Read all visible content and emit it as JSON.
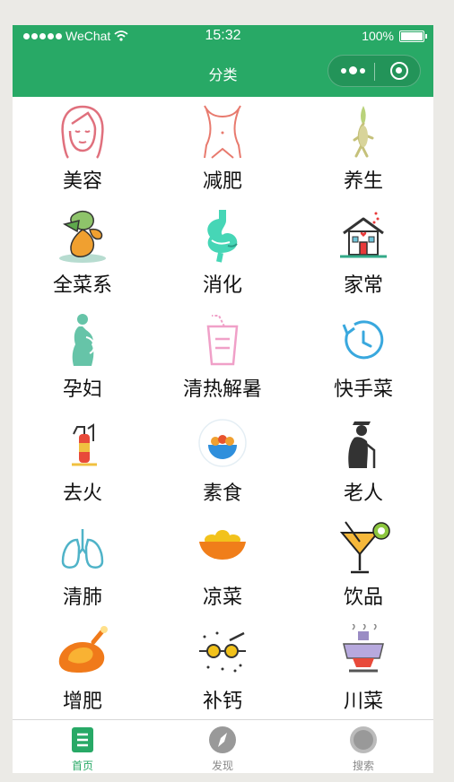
{
  "status_bar": {
    "carrier": "WeChat",
    "time": "15:32",
    "battery": "100%"
  },
  "nav": {
    "title": "分类"
  },
  "categories": [
    {
      "label": "美容",
      "icon": "woman-face-icon"
    },
    {
      "label": "减肥",
      "icon": "waist-icon"
    },
    {
      "label": "养生",
      "icon": "ginseng-icon"
    },
    {
      "label": "全菜系",
      "icon": "vegetables-icon"
    },
    {
      "label": "消化",
      "icon": "stomach-icon"
    },
    {
      "label": "家常",
      "icon": "house-icon"
    },
    {
      "label": "孕妇",
      "icon": "pregnant-woman-icon"
    },
    {
      "label": "清热解暑",
      "icon": "drink-cup-icon"
    },
    {
      "label": "快手菜",
      "icon": "clock-icon"
    },
    {
      "label": "去火",
      "icon": "fire-extinguisher-icon"
    },
    {
      "label": "素食",
      "icon": "salad-bowl-icon"
    },
    {
      "label": "老人",
      "icon": "elderly-person-icon"
    },
    {
      "label": "清肺",
      "icon": "lungs-icon"
    },
    {
      "label": "凉菜",
      "icon": "cold-dish-icon"
    },
    {
      "label": "饮品",
      "icon": "cocktail-icon"
    },
    {
      "label": "增肥",
      "icon": "roast-chicken-icon"
    },
    {
      "label": "补钙",
      "icon": "bone-icon"
    },
    {
      "label": "川菜",
      "icon": "hotpot-icon"
    }
  ],
  "tabs": [
    {
      "label": "首页",
      "icon": "home-list-icon",
      "active": true
    },
    {
      "label": "发现",
      "icon": "compass-icon",
      "active": false
    },
    {
      "label": "搜索",
      "icon": "search-circle-icon",
      "active": false
    }
  ],
  "colors": {
    "brand_green": "#28a966",
    "tab_inactive": "#888888"
  }
}
